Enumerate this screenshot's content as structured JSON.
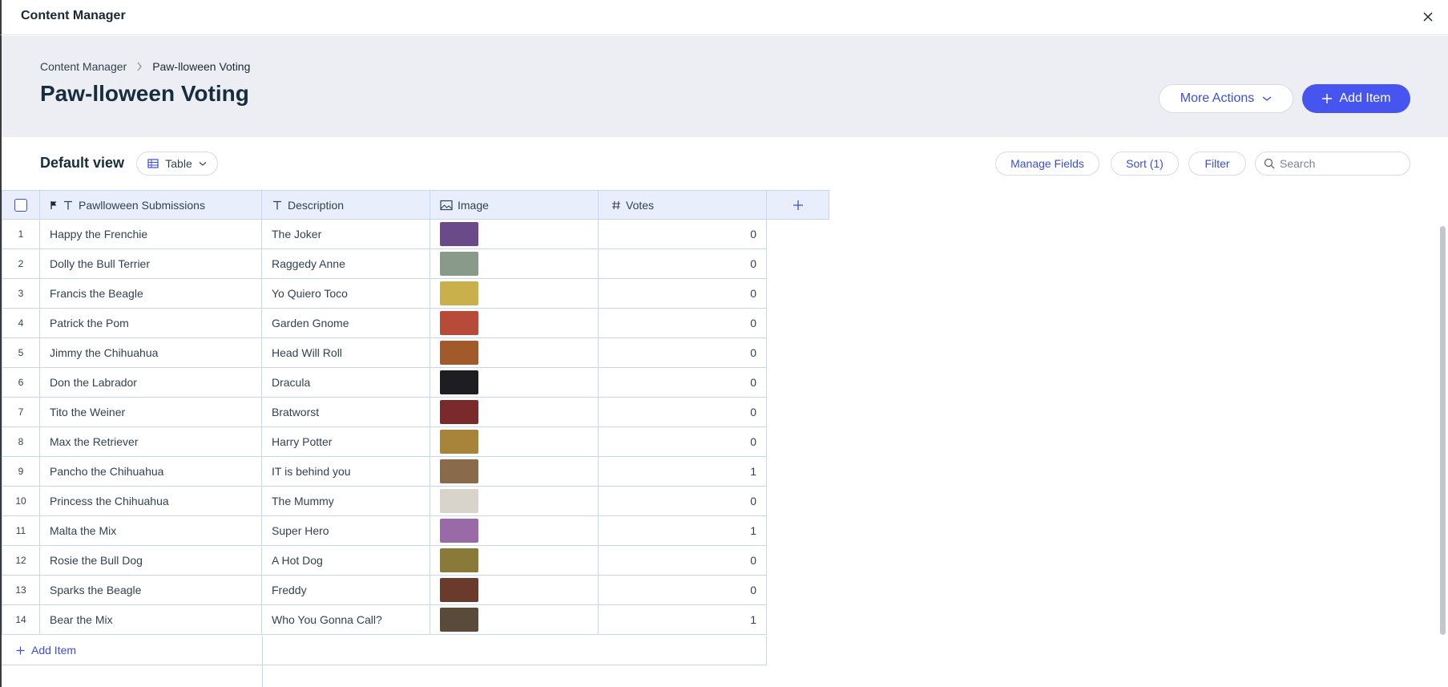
{
  "window": {
    "title": "Content Manager"
  },
  "breadcrumb": {
    "root": "Content Manager",
    "current": "Paw-lloween Voting"
  },
  "page": {
    "title": "Paw-lloween Voting"
  },
  "actions": {
    "more_label": "More Actions",
    "add_label": "Add Item"
  },
  "toolbar": {
    "view_title": "Default view",
    "view_type": "Table",
    "manage_fields": "Manage Fields",
    "sort": "Sort (1)",
    "filter": "Filter",
    "search_placeholder": "Search"
  },
  "table": {
    "columns": [
      {
        "label": "Pawlloween Submissions",
        "icon": "text-icon",
        "primary": true
      },
      {
        "label": "Description",
        "icon": "text-icon"
      },
      {
        "label": "Image",
        "icon": "image-icon"
      },
      {
        "label": "Votes",
        "icon": "hash-icon"
      }
    ],
    "rows": [
      {
        "num": "1",
        "name": "Happy the Frenchie",
        "desc": "The Joker",
        "votes": "0",
        "thumb": "#6b4a8a"
      },
      {
        "num": "2",
        "name": "Dolly the Bull Terrier",
        "desc": "Raggedy Anne",
        "votes": "0",
        "thumb": "#8a9a8a"
      },
      {
        "num": "3",
        "name": "Francis the Beagle",
        "desc": "Yo Quiero Toco",
        "votes": "0",
        "thumb": "#c9b04a"
      },
      {
        "num": "4",
        "name": "Patrick the Pom",
        "desc": "Garden Gnome",
        "votes": "0",
        "thumb": "#b84a3a"
      },
      {
        "num": "5",
        "name": "Jimmy the Chihuahua",
        "desc": "Head Will Roll",
        "votes": "0",
        "thumb": "#a35a2a"
      },
      {
        "num": "6",
        "name": "Don the Labrador",
        "desc": "Dracula",
        "votes": "0",
        "thumb": "#1e1e22"
      },
      {
        "num": "7",
        "name": "Tito the Weiner",
        "desc": "Bratworst",
        "votes": "0",
        "thumb": "#7a2a2a"
      },
      {
        "num": "8",
        "name": "Max the Retriever",
        "desc": "Harry Potter",
        "votes": "0",
        "thumb": "#a8843a"
      },
      {
        "num": "9",
        "name": "Pancho the Chihuahua",
        "desc": "IT is behind you",
        "votes": "1",
        "thumb": "#8a6a4a"
      },
      {
        "num": "10",
        "name": "Princess the Chihuahua",
        "desc": "The Mummy",
        "votes": "0",
        "thumb": "#d8d4cc"
      },
      {
        "num": "11",
        "name": "Malta the Mix",
        "desc": "Super Hero",
        "votes": "1",
        "thumb": "#9a6aa8"
      },
      {
        "num": "12",
        "name": "Rosie the Bull Dog",
        "desc": "A Hot Dog",
        "votes": "0",
        "thumb": "#8a7a3a"
      },
      {
        "num": "13",
        "name": "Sparks the Beagle",
        "desc": "Freddy",
        "votes": "0",
        "thumb": "#6a3a2a"
      },
      {
        "num": "14",
        "name": "Bear the Mix",
        "desc": "Who You Gonna Call?",
        "votes": "1",
        "thumb": "#5a4a3a"
      }
    ],
    "add_item_label": "Add Item"
  },
  "colors": {
    "accent": "#4755f0",
    "link": "#3b4ed6",
    "header_bg": "#eceef3",
    "grid_line": "#c7d6ef",
    "col_header_bg": "#e8eefb"
  }
}
